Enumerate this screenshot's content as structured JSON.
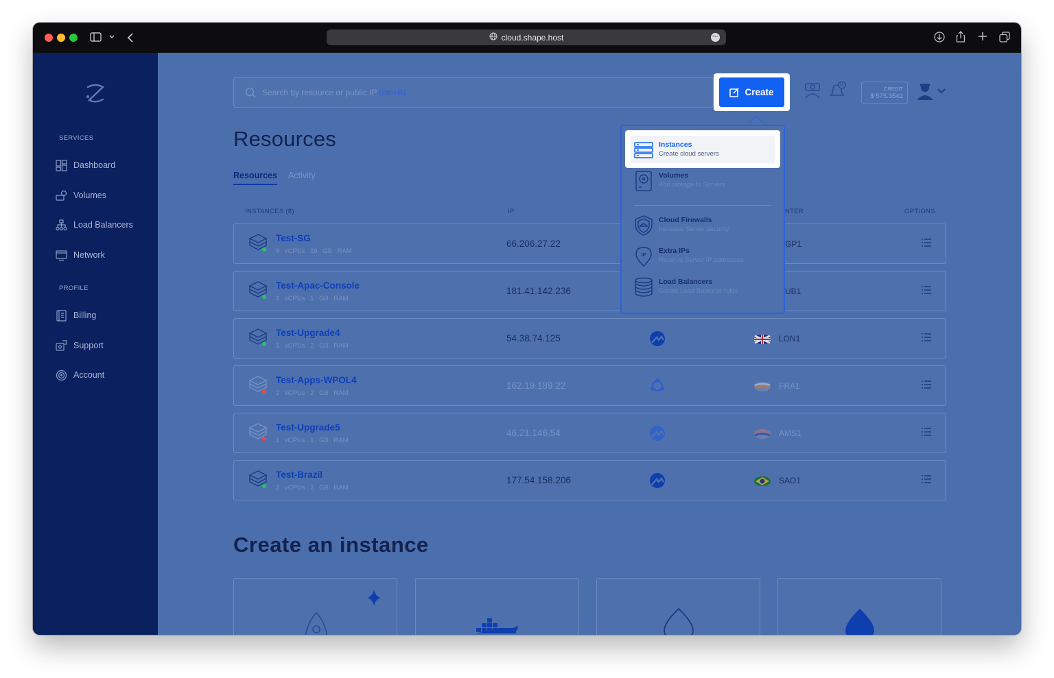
{
  "browser": {
    "url": "cloud.shape.host"
  },
  "sidebar": {
    "services_label": "SERVICES",
    "profile_label": "PROFILE",
    "items": [
      {
        "label": "Dashboard",
        "icon": "dashboard-icon"
      },
      {
        "label": "Volumes",
        "icon": "volumes-icon"
      },
      {
        "label": "Load Balancers",
        "icon": "load-balancer-icon"
      },
      {
        "label": "Network",
        "icon": "network-icon"
      },
      {
        "label": "Billing",
        "icon": "billing-icon"
      },
      {
        "label": "Support",
        "icon": "support-icon"
      },
      {
        "label": "Account",
        "icon": "account-icon"
      }
    ]
  },
  "header": {
    "search_placeholder": "Search by resource or public IP",
    "search_shortcut": "(ctrl+B)",
    "create_label": "Create",
    "notification_count": "0",
    "credit_label": "CREDIT",
    "credit_value": "$ 575.3542"
  },
  "page": {
    "title": "Resources",
    "tabs": [
      "Resources",
      "Activity"
    ],
    "columns": {
      "instances": "INSTANCES (8)",
      "ip": "IP",
      "datacenter": "NTER",
      "options": "OPTIONS"
    }
  },
  "instances": [
    {
      "name": "Test-SG",
      "spec": "6 vCPUs 16 GB RAM",
      "ip": "66.206.27.22",
      "location": "GP1",
      "status": "running"
    },
    {
      "name": "Test-Apac-Console",
      "spec": "1 vCPUs 1 GB RAM",
      "ip": "181.41.142.236",
      "location": "UB1",
      "status": "running"
    },
    {
      "name": "Test-Upgrade4",
      "spec": "1 vCPUs 2 GB RAM",
      "ip": "54.38.74.125",
      "location": "LON1",
      "status": "running"
    },
    {
      "name": "Test-Apps-WPOL4",
      "spec": "2 vCPUs 2 GB RAM",
      "ip": "162.19.189.22",
      "location": "FRA1",
      "status": "stopped"
    },
    {
      "name": "Test-Upgrade5",
      "spec": "1 vCPUs 1 GB RAM",
      "ip": "46.21.146.54",
      "location": "AMS1",
      "status": "stopped"
    },
    {
      "name": "Test-Brazil",
      "spec": "2 vCPUs 2 GB RAM",
      "ip": "177.54.158.206",
      "location": "SAO1",
      "status": "running"
    }
  ],
  "create_section": {
    "title": "Create an instance"
  },
  "create_menu": [
    {
      "title": "Instances",
      "subtitle": "Create cloud servers",
      "icon": "server-stack-icon"
    },
    {
      "title": "Volumes",
      "subtitle": "Add storage to Servers",
      "icon": "hard-drive-icon"
    },
    {
      "title": "Cloud Firewalls",
      "subtitle": "Increase Server security",
      "icon": "shield-icon"
    },
    {
      "title": "Extra IPs",
      "subtitle": "Reserve Server IP addresses",
      "icon": "ip-pin-icon"
    },
    {
      "title": "Load Balancers",
      "subtitle": "Create Load Balancer rules",
      "icon": "database-stack-icon"
    }
  ],
  "colors": {
    "sidebar": "#0a205f",
    "overlay": "#4b6fad",
    "accent": "#1162f2",
    "running": "#22c55e",
    "stopped": "#ef4444"
  }
}
